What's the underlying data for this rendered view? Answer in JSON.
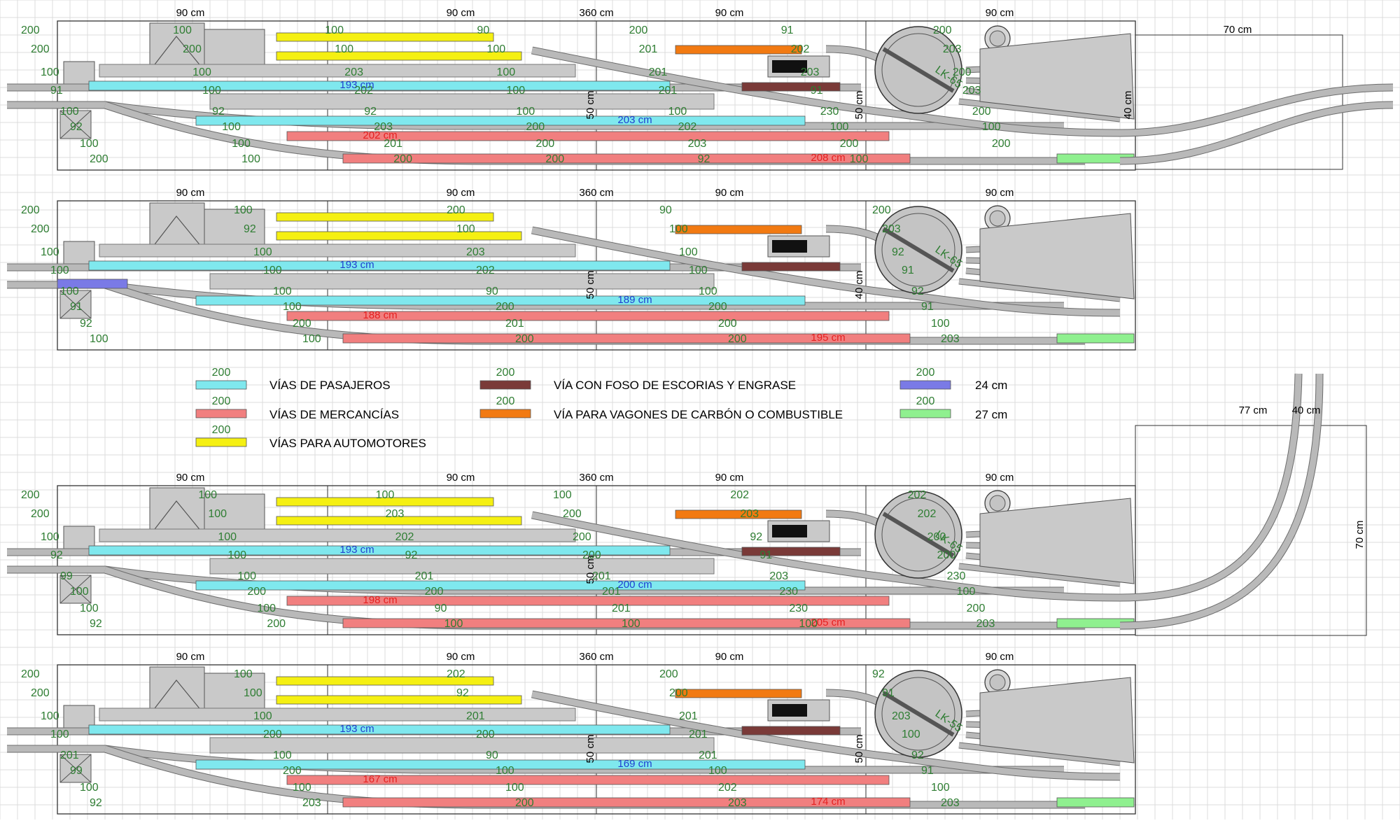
{
  "colors": {
    "grid": "#dcdcdc",
    "track": "#b9b9b9",
    "track_edge": "#6d6d6d",
    "passenger": "#7fe8ee",
    "freight": "#f17f7f",
    "railcar": "#f5f012",
    "ash_pit": "#7a3a38",
    "coal": "#f27a12",
    "short_24": "#7a7ae6",
    "short_27": "#8ff08f",
    "building": "#c9c9c9",
    "label_green": "#2e7d32",
    "label_blue": "#1f3fd0",
    "label_red": "#e52020"
  },
  "legend": [
    {
      "color_key": "passenger",
      "num": "200",
      "text": "VÍAS DE PASAJEROS"
    },
    {
      "color_key": "freight",
      "num": "200",
      "text": "VÍAS DE MERCANCÍAS"
    },
    {
      "color_key": "railcar",
      "num": "200",
      "text": "VÍAS PARA AUTOMOTORES"
    },
    {
      "color_key": "ash_pit",
      "num": "200",
      "text": "VÍA CON FOSO DE ESCORIAS Y ENGRASE"
    },
    {
      "color_key": "coal",
      "num": "200",
      "text": "VÍA PARA VAGONES DE CARBÓN O COMBUSTIBLE"
    },
    {
      "color_key": "short_24",
      "num": "200",
      "text": "24 cm"
    },
    {
      "color_key": "short_27",
      "num": "200",
      "text": "27 cm"
    }
  ],
  "top_dimensions": [
    "90 cm",
    "90 cm",
    "360 cm",
    "90 cm",
    "90 cm"
  ],
  "turntable_labels": [
    "LK-65",
    "LK-65",
    "LK-65",
    "LK-55"
  ],
  "plans": [
    {
      "plan_label": "plan-1",
      "extension_labels": [
        "70 cm"
      ],
      "side_labels": [
        "50 cm",
        "50 cm",
        "40 cm"
      ],
      "length_labels": [
        {
          "text": "193 cm",
          "kind": "blue"
        },
        {
          "text": "203 cm",
          "kind": "blue"
        },
        {
          "text": "202 cm",
          "kind": "red"
        },
        {
          "text": "208 cm",
          "kind": "red"
        }
      ],
      "piece_numbers": [
        "200",
        "200",
        "100",
        "91",
        "100",
        "92",
        "100",
        "200",
        "100",
        "200",
        "100",
        "100",
        "92",
        "100",
        "100",
        "100",
        "100",
        "100",
        "203",
        "202",
        "92",
        "203",
        "201",
        "200",
        "90",
        "100",
        "100",
        "100",
        "100",
        "200",
        "200",
        "200",
        "200",
        "201",
        "201",
        "201",
        "100",
        "202",
        "203",
        "92",
        "91",
        "202",
        "203",
        "91",
        "230",
        "100",
        "200",
        "100",
        "200",
        "203",
        "200",
        "203",
        "200",
        "100",
        "200"
      ]
    },
    {
      "plan_label": "plan-2",
      "extension_labels": [],
      "side_labels": [
        "50 cm",
        "40 cm"
      ],
      "length_labels": [
        {
          "text": "193 cm",
          "kind": "blue"
        },
        {
          "text": "189 cm",
          "kind": "blue"
        },
        {
          "text": "188 cm",
          "kind": "red"
        },
        {
          "text": "195 cm",
          "kind": "red"
        }
      ],
      "piece_numbers": [
        "200",
        "200",
        "100",
        "100",
        "100",
        "91",
        "92",
        "100",
        "100",
        "92",
        "100",
        "100",
        "100",
        "100",
        "200",
        "100",
        "200",
        "100",
        "203",
        "202",
        "90",
        "200",
        "201",
        "200",
        "90",
        "100",
        "100",
        "100",
        "100",
        "200",
        "200",
        "200",
        "200",
        "203",
        "92",
        "91",
        "92",
        "91",
        "100",
        "203"
      ]
    },
    {
      "plan_label": "plan-3",
      "extension_labels": [
        "77 cm",
        "40 cm",
        "70 cm"
      ],
      "side_labels": [
        "50 cm"
      ],
      "length_labels": [
        {
          "text": "193 cm",
          "kind": "blue"
        },
        {
          "text": "200 cm",
          "kind": "blue"
        },
        {
          "text": "198 cm",
          "kind": "red"
        },
        {
          "text": "205 cm",
          "kind": "red"
        }
      ],
      "piece_numbers": [
        "200",
        "200",
        "100",
        "92",
        "99",
        "100",
        "100",
        "92",
        "100",
        "100",
        "100",
        "100",
        "100",
        "200",
        "100",
        "200",
        "100",
        "203",
        "202",
        "92",
        "201",
        "200",
        "90",
        "100",
        "100",
        "200",
        "200",
        "200",
        "201",
        "201",
        "201",
        "100",
        "202",
        "203",
        "92",
        "91",
        "203",
        "230",
        "230",
        "100",
        "202",
        "202",
        "200",
        "200",
        "230",
        "100",
        "200",
        "203"
      ]
    },
    {
      "plan_label": "plan-4",
      "extension_labels": [],
      "side_labels": [
        "50 cm",
        "50 cm"
      ],
      "length_labels": [
        {
          "text": "193 cm",
          "kind": "blue"
        },
        {
          "text": "169 cm",
          "kind": "blue"
        },
        {
          "text": "167 cm",
          "kind": "red"
        },
        {
          "text": "174 cm",
          "kind": "red"
        }
      ],
      "piece_numbers": [
        "200",
        "200",
        "100",
        "100",
        "201",
        "99",
        "100",
        "92",
        "100",
        "100",
        "100",
        "200",
        "100",
        "200",
        "100",
        "203",
        "202",
        "92",
        "201",
        "200",
        "90",
        "100",
        "100",
        "200",
        "200",
        "200",
        "201",
        "201",
        "201",
        "100",
        "202",
        "203",
        "92",
        "91",
        "203",
        "100",
        "92",
        "91",
        "100",
        "203"
      ]
    }
  ]
}
